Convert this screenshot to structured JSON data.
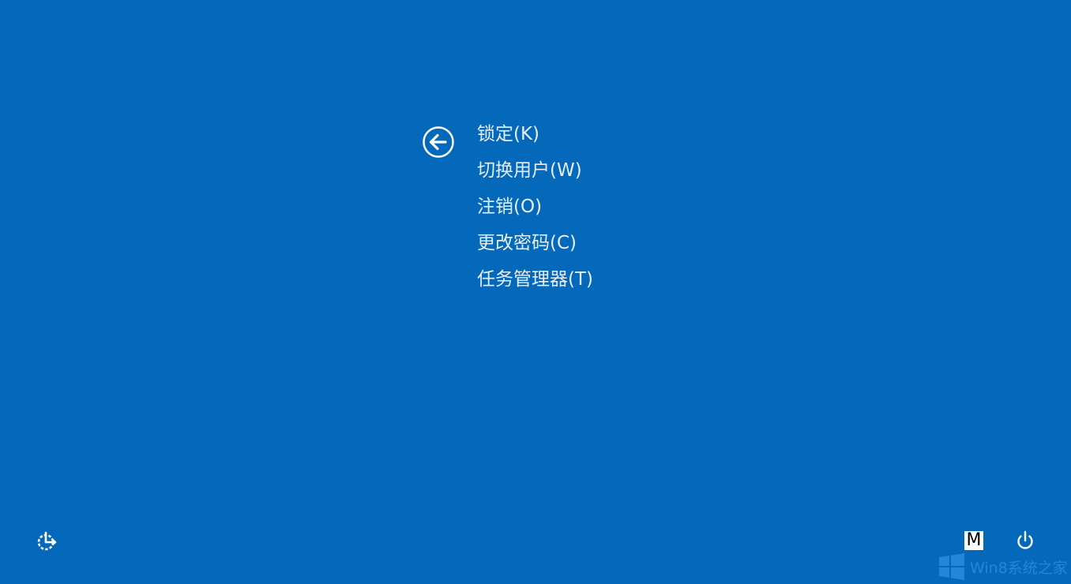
{
  "background_color": "#0468BB",
  "text_color": "#E6EFF8",
  "back_button": {
    "icon": "back-arrow-circle-icon"
  },
  "menu": {
    "items": [
      {
        "label": "锁定(K)"
      },
      {
        "label": "切换用户(W)"
      },
      {
        "label": "注销(O)"
      },
      {
        "label": "更改密码(C)"
      },
      {
        "label": "任务管理器(T)"
      }
    ]
  },
  "bottom_bar": {
    "ease_of_access_icon": "ease-of-access-icon",
    "input_method_label": "M",
    "power_icon": "power-icon"
  },
  "watermark": {
    "logo_icon": "windows-logo-icon",
    "text": "Win8系统之家"
  }
}
